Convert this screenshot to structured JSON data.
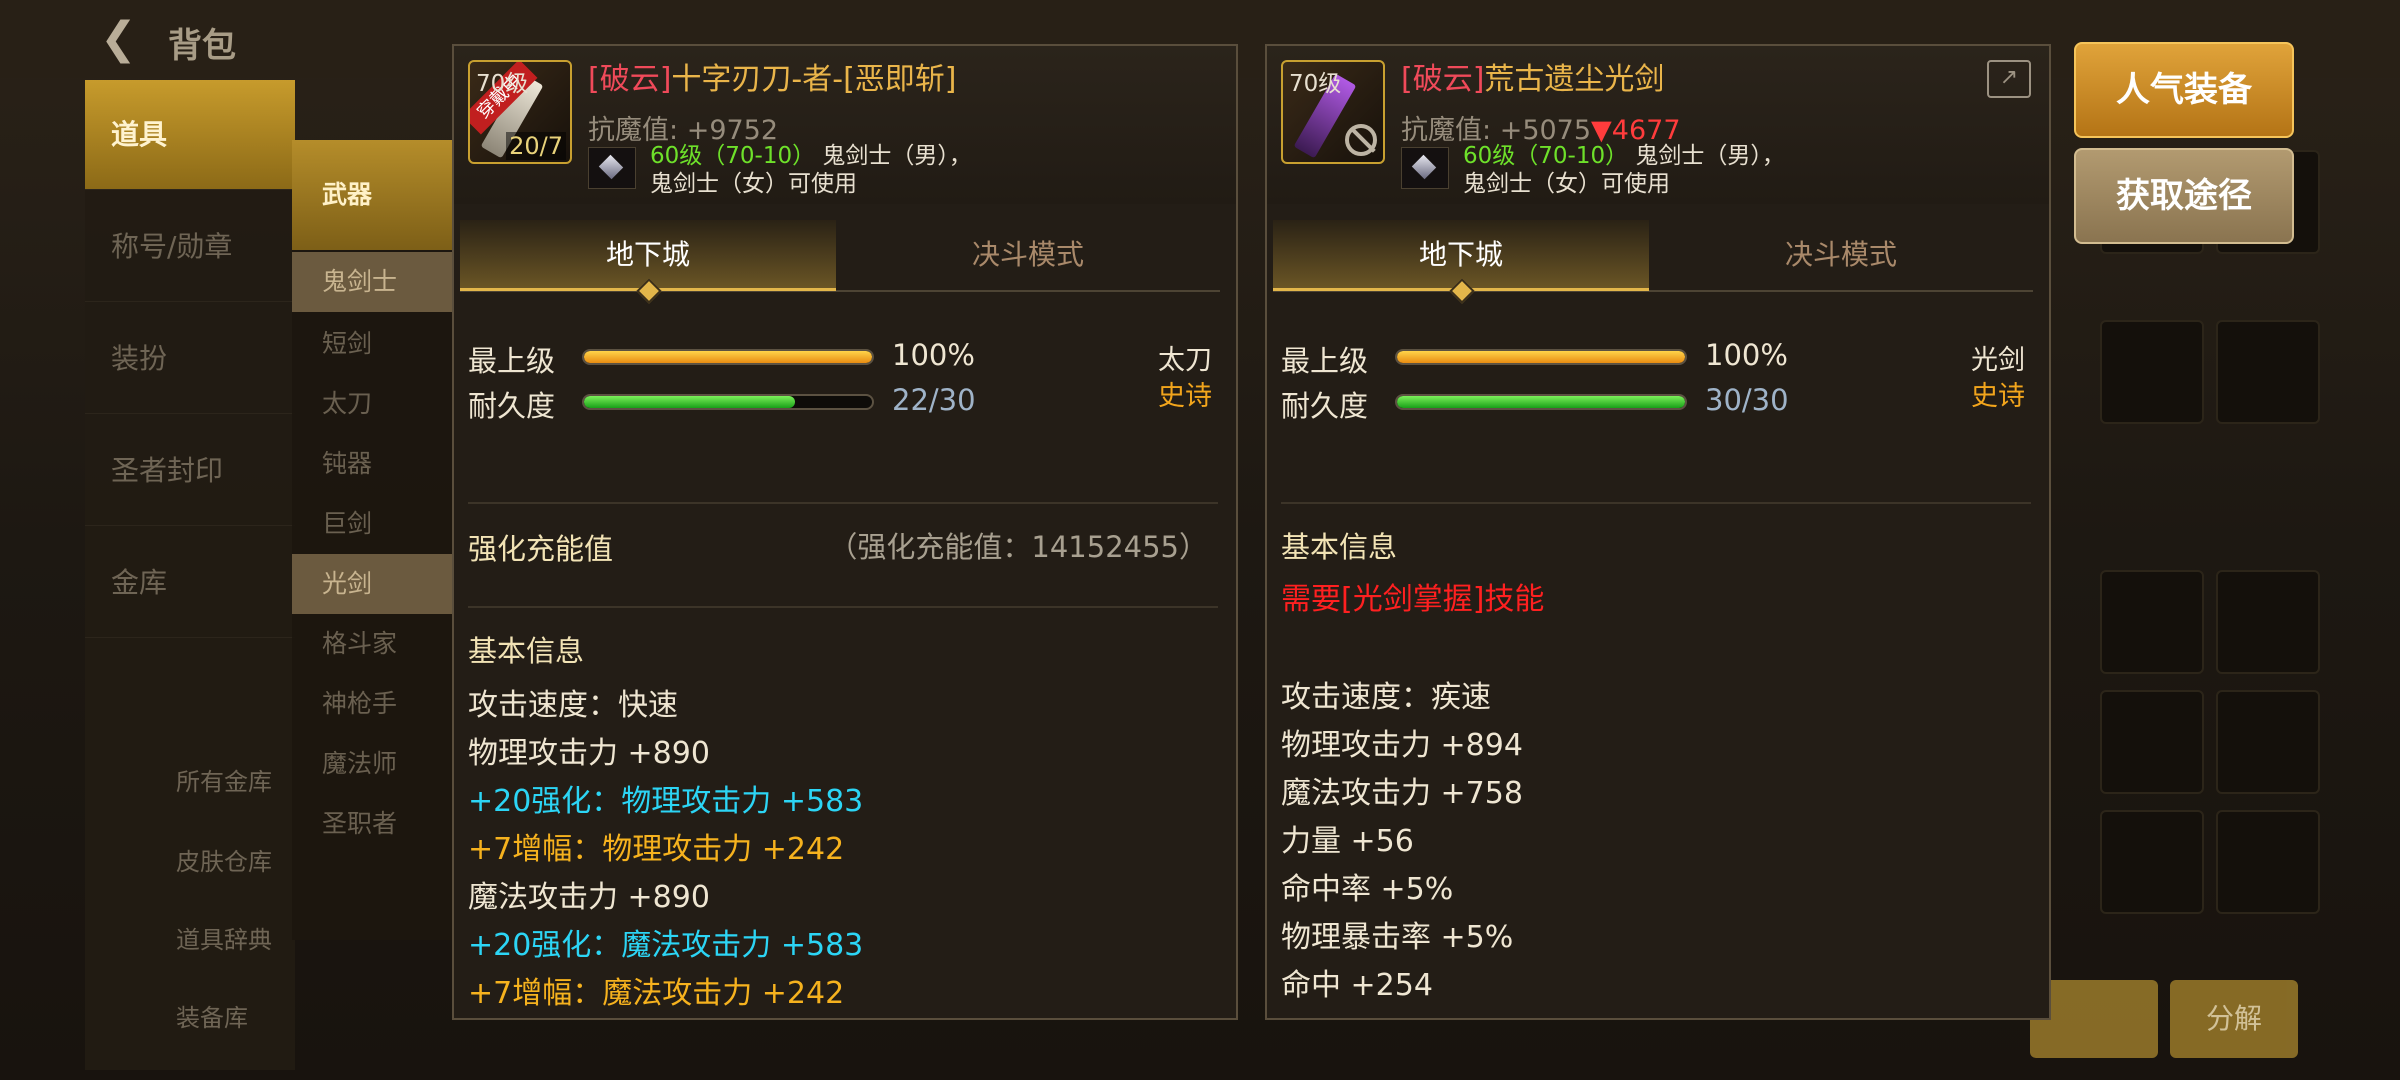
{
  "background": {
    "title": "背包",
    "categories": [
      "道具",
      "称号/勋章",
      "装扮",
      "圣者封印",
      "金库"
    ],
    "subcategories": [
      "武器",
      "鬼剑士",
      "短剑",
      "太刀",
      "钝器",
      "巨剑",
      "光剑",
      "格斗家",
      "神枪手",
      "魔法师",
      "圣职者"
    ],
    "links": [
      "所有金库",
      "皮肤仓库",
      "道具辞典",
      "装备库"
    ],
    "bottom_buttons": [
      "",
      "分解"
    ]
  },
  "item_left": {
    "level_badge": "70级",
    "count": "20/7",
    "ribbon": "穿戴中",
    "name_prefix": "[破云]",
    "name": "十字刃刀-者-[恶即斩]",
    "resist_label": "抗魔值:",
    "resist_value": "+9752",
    "req_level": "60级（70-10）",
    "req_class1": "鬼剑士（男），",
    "req_class2": "鬼剑士（女）可使用",
    "tab_dungeon": "地下城",
    "tab_pvp": "决斗模式",
    "grade_label": "最上级",
    "grade_pct": "100%",
    "grade_value": 1.0,
    "dur_label": "耐久度",
    "dur_text": "22/30",
    "dur_value": 0.733,
    "weapon_type": "太刀",
    "rarity": "史诗",
    "enhance_title": "强化充能值",
    "enhance_value": "（强化充能值：14152455）",
    "basic_title": "基本信息",
    "lines": [
      {
        "text": "攻击速度：快速",
        "color": "normal"
      },
      {
        "text": "物理攻击力 +890",
        "color": "normal"
      },
      {
        "text": "+20强化：物理攻击力 +583",
        "color": "cyan"
      },
      {
        "text": " +7增幅：物理攻击力 +242",
        "color": "orange"
      },
      {
        "text": "魔法攻击力 +890",
        "color": "normal"
      },
      {
        "text": "+20强化：魔法攻击力 +583",
        "color": "cyan"
      },
      {
        "text": " +7增幅：魔法攻击力 +242",
        "color": "orange"
      }
    ]
  },
  "item_right": {
    "level_badge": "70级",
    "name_prefix": "[破云]",
    "name": "荒古遗尘光剑",
    "resist_label": "抗魔值:",
    "resist_value": "+5075",
    "resist_diff": "▼4677",
    "req_level": "60级（70-10）",
    "req_class1": "鬼剑士（男），",
    "req_class2": "鬼剑士（女）可使用",
    "tab_dungeon": "地下城",
    "tab_pvp": "决斗模式",
    "grade_label": "最上级",
    "grade_pct": "100%",
    "grade_value": 1.0,
    "dur_label": "耐久度",
    "dur_text": "30/30",
    "dur_value": 1.0,
    "weapon_type": "光剑",
    "rarity": "史诗",
    "basic_title": "基本信息",
    "requirement": "需要[光剑掌握]技能",
    "lines": [
      {
        "text": "攻击速度：疾速",
        "color": "normal"
      },
      {
        "text": "物理攻击力 +894",
        "color": "normal"
      },
      {
        "text": "魔法攻击力 +758",
        "color": "normal"
      },
      {
        "text": "力量 +56",
        "color": "normal"
      },
      {
        "text": "命中率 +5%",
        "color": "normal"
      },
      {
        "text": "物理暴击率 +5%",
        "color": "normal"
      },
      {
        "text": "命中 +254",
        "color": "normal"
      }
    ]
  },
  "side_buttons": {
    "popular": "人气装备",
    "obtain": "获取途径"
  },
  "colors": {
    "accent": "#e3b64a",
    "cyan": "#2cd5f5",
    "orange": "#f6b21e",
    "red": "#ff2020"
  }
}
